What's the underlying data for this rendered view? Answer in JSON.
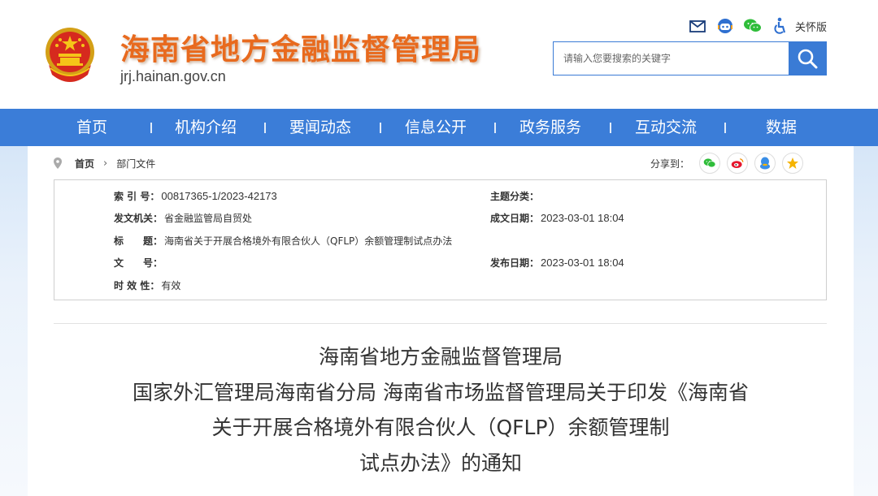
{
  "header": {
    "site_title": "海南省地方金融监督管理局",
    "site_domain": "jrj.hainan.gov.cn",
    "care_link": "关怀版",
    "icons": [
      "mail-icon",
      "robot-icon",
      "wechat-icon",
      "accessibility-icon"
    ],
    "search_placeholder": "请输入您要搜索的关键字"
  },
  "nav": {
    "items": [
      "首页",
      "机构介绍",
      "要闻动态",
      "信息公开",
      "政务服务",
      "互动交流",
      "数据"
    ]
  },
  "breadcrumb": {
    "home": "首页",
    "current": "部门文件"
  },
  "share": {
    "label": "分享到：",
    "targets": [
      "wechat",
      "weibo",
      "qq",
      "qzone"
    ],
    "colors": {
      "wechat": "#2fbd3a",
      "weibo": "#e6162d",
      "qq": "#3a8ee6",
      "qzone": "#f5b400"
    }
  },
  "info": {
    "index_label": "索 引 号：",
    "index_value": "00817365-1/2023-42173",
    "topic_label": "主题分类：",
    "topic_value": "",
    "issuer_label": "发文机关：",
    "issuer_value": "省金融监管局自贸处",
    "created_label": "成文日期：",
    "created_value": "2023-03-01 18:04",
    "title_label": "标　　题：",
    "title_value": "海南省关于开展合格境外有限合伙人（QFLP）余额管理制试点办法",
    "docno_label": "文　　号：",
    "docno_value": "",
    "published_label": "发布日期：",
    "published_value": "2023-03-01 18:04",
    "validity_label": "时 效 性：",
    "validity_value": "有效"
  },
  "document": {
    "title_lines": [
      "海南省地方金融监督管理局",
      "国家外汇管理局海南省分局 海南省市场监督管理局关于印发《海南省",
      "关于开展合格境外有限合伙人（QFLP）余额管理制",
      "试点办法》的通知"
    ]
  },
  "colors": {
    "nav_blue": "#3b7dd8",
    "title_orange": "#e86a1e",
    "search_blue": "#3a7bd5"
  }
}
